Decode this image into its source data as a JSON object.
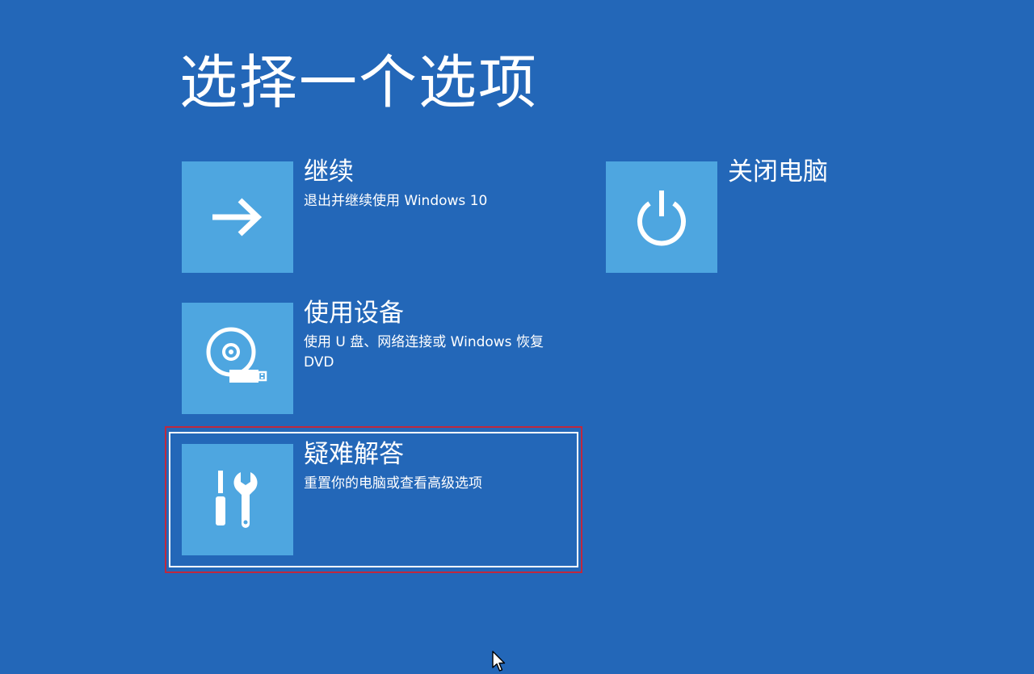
{
  "page": {
    "title": "选择一个选项"
  },
  "options": {
    "continue": {
      "label": "继续",
      "description": "退出并继续使用 Windows 10",
      "icon": "arrow-right-icon"
    },
    "shutdown": {
      "label": "关闭电脑",
      "icon": "power-icon"
    },
    "use_device": {
      "label": "使用设备",
      "description": "使用 U 盘、网络连接或 Windows 恢复 DVD",
      "icon": "disc-usb-icon"
    },
    "troubleshoot": {
      "label": "疑难解答",
      "description": "重置你的电脑或查看高级选项",
      "icon": "tools-icon",
      "selected": true
    }
  },
  "colors": {
    "background": "#2367b8",
    "tile": "#4ea6e0",
    "focus_outline": "#ffffff",
    "highlight_outline": "#c0283e"
  }
}
